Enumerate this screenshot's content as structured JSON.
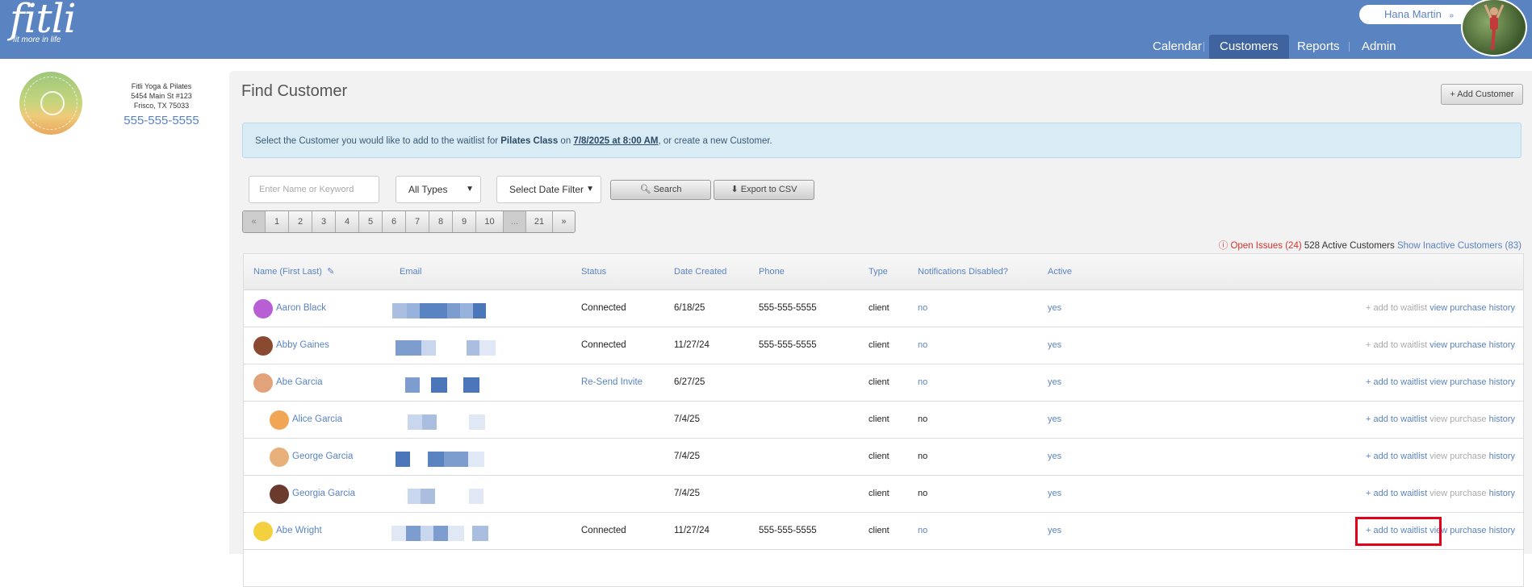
{
  "header": {
    "logo_text": "fitli",
    "logo_tagline": "fit more in life",
    "user_name": "Hana Martin",
    "user_chevron": "»",
    "nav": [
      {
        "label": "Calendar",
        "active": false
      },
      {
        "label": "Customers",
        "active": true
      },
      {
        "label": "Reports",
        "active": false
      },
      {
        "label": "Admin",
        "active": false
      }
    ]
  },
  "studio": {
    "name": "Fitli Yoga & Pilates",
    "address1": "5454 Main St #123",
    "address2": "Frisco, TX 75033",
    "phone": "555-555-5555"
  },
  "page": {
    "title": "Find Customer",
    "add_customer": "+ Add Customer",
    "alert": {
      "prefix": "Select the Customer you would like to add to the waitlist for ",
      "class_name": "Pilates Class",
      "on": " on ",
      "datetime": "7/8/2025 at 8:00 AM",
      "suffix": ", or create a new Customer."
    }
  },
  "filters": {
    "search_placeholder": "Enter Name or Keyword",
    "types_value": "All Types",
    "date_value": "Select Date Filter",
    "search_button": "Search",
    "export_button": "Export to CSV",
    "pagination": [
      "«",
      "1",
      "2",
      "3",
      "4",
      "5",
      "6",
      "7",
      "8",
      "9",
      "10",
      "...",
      "21",
      "»"
    ]
  },
  "summary": {
    "open_issues": "Open Issues (24)",
    "active_customers": "528 Active Customers",
    "show_inactive": "Show Inactive Customers (83)"
  },
  "table": {
    "columns": [
      "Name (First Last)",
      "Email",
      "Status",
      "Date Created",
      "Phone",
      "Type",
      "Notifications Disabled?",
      "Active"
    ],
    "action_labels": {
      "add": "+ add to waitlist",
      "view": "view",
      "purchase": "purchase",
      "history": "history"
    },
    "rows": [
      {
        "name": "Aaron Black",
        "status": "Connected",
        "date": "6/18/25",
        "phone": "555-555-5555",
        "type": "client",
        "notif": "no",
        "active": "yes",
        "add_enabled": false,
        "purchase_enabled": true
      },
      {
        "name": "Abby Gaines",
        "status": "Connected",
        "date": "11/27/24",
        "phone": "555-555-5555",
        "type": "client",
        "notif": "no",
        "active": "yes",
        "add_enabled": false,
        "purchase_enabled": true
      },
      {
        "name": "Abe Garcia",
        "status": "Re-Send Invite",
        "date": "6/27/25",
        "phone": "",
        "type": "client",
        "notif": "no",
        "active": "yes",
        "add_enabled": true,
        "purchase_enabled": true
      },
      {
        "name": "Alice Garcia",
        "status": "",
        "date": "7/4/25",
        "phone": "",
        "type": "client",
        "notif": "no",
        "active": "yes",
        "add_enabled": true,
        "purchase_enabled": false
      },
      {
        "name": "George Garcia",
        "status": "",
        "date": "7/4/25",
        "phone": "",
        "type": "client",
        "notif": "no",
        "active": "yes",
        "add_enabled": true,
        "purchase_enabled": false
      },
      {
        "name": "Georgia Garcia",
        "status": "",
        "date": "7/4/25",
        "phone": "",
        "type": "client",
        "notif": "no",
        "active": "yes",
        "add_enabled": true,
        "purchase_enabled": false
      },
      {
        "name": "Abe Wright",
        "status": "Connected",
        "date": "11/27/24",
        "phone": "555-555-5555",
        "type": "client",
        "notif": "no",
        "active": "yes",
        "add_enabled": true,
        "purchase_enabled": true
      }
    ]
  },
  "colors": {
    "header": "#5a83c2",
    "link": "#5a83c2",
    "alert_bg": "#d9ecf5",
    "highlight": "#e3001b",
    "issues": "#d9332e"
  }
}
